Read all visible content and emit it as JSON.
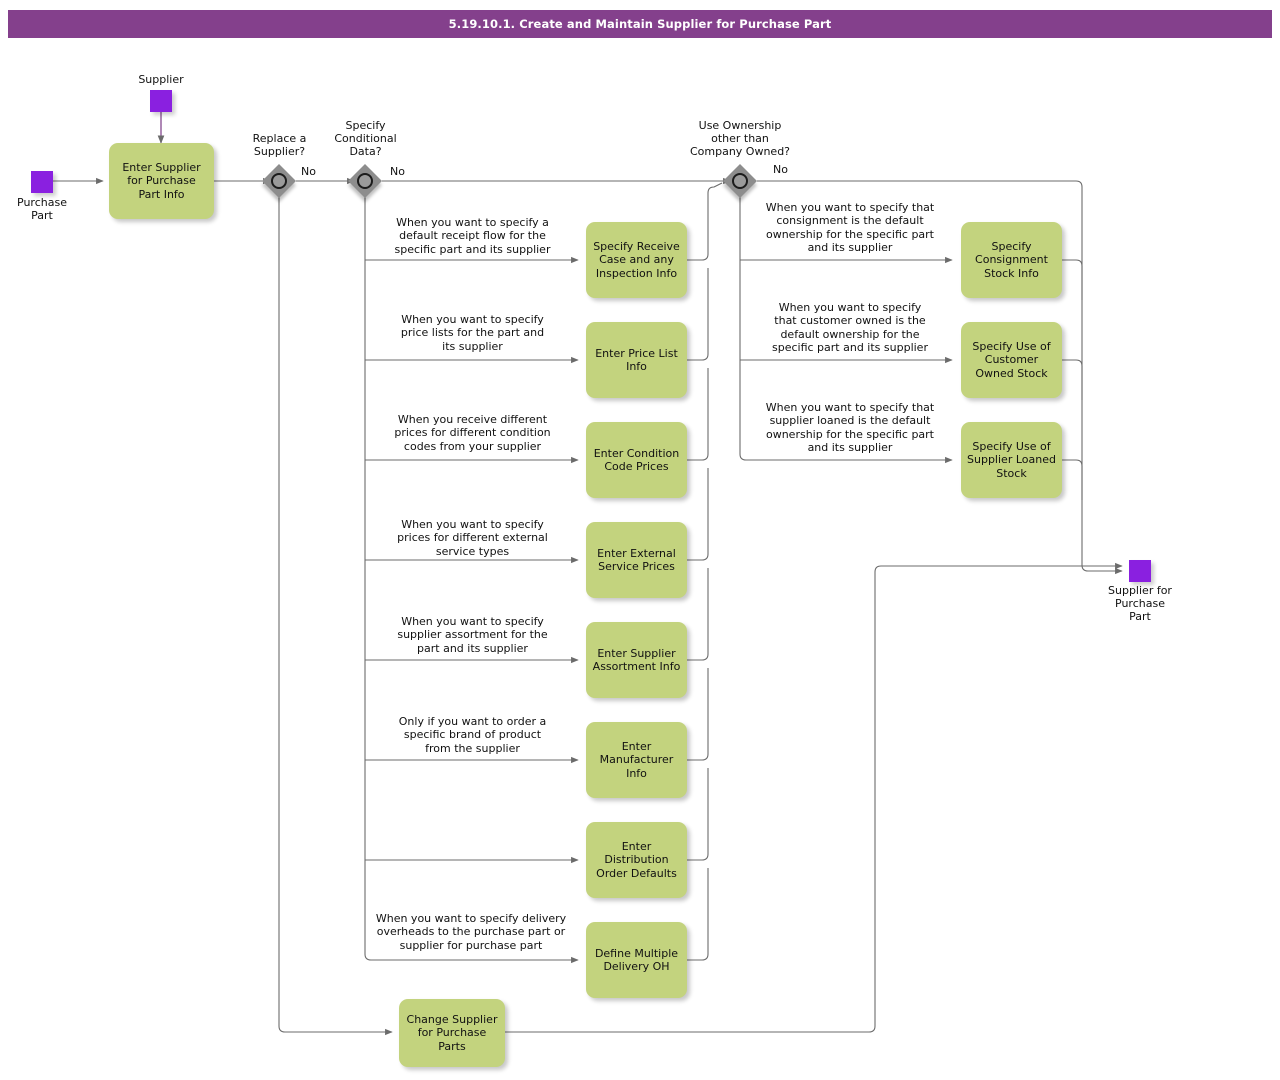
{
  "title": "5.19.10.1. Create and Maintain Supplier for Purchase Part",
  "colors": {
    "title_bar": "#84408c",
    "task_fill": "#c3d37e",
    "data_object_fill": "#8a20e0",
    "gateway_fill": "#8d8d8d",
    "connector": "#6b6b6b"
  },
  "data_objects": {
    "start_purchase_part": "Purchase\nPart",
    "supplier_input": "Supplier",
    "end_supplier_for_purchase_part": "Supplier for\nPurchase\nPart"
  },
  "gateways": [
    {
      "id": "gw-replace-supplier",
      "label": "Replace a\nSupplier?",
      "default_label": "No"
    },
    {
      "id": "gw-specify-conditional-data",
      "label": "Specify\nConditional\nData?",
      "default_label": "No"
    },
    {
      "id": "gw-use-ownership",
      "label": "Use Ownership\nother than\nCompany Owned?",
      "default_label": "No"
    }
  ],
  "tasks": {
    "enter_supplier_for_purchase_part_info": "Enter Supplier\nfor Purchase\nPart Info",
    "specify_receive_case": "Specify Receive\nCase and any\nInspection Info",
    "enter_price_list_info": "Enter Price List\nInfo",
    "enter_condition_code_prices": "Enter Condition\nCode Prices",
    "enter_external_service_prices": "Enter External\nService Prices",
    "enter_supplier_assortment_info": "Enter Supplier\nAssortment Info",
    "enter_manufacturer_info": "Enter\nManufacturer\nInfo",
    "enter_distribution_order_defaults": "Enter\nDistribution\nOrder Defaults",
    "define_multiple_delivery_oh": "Define Multiple\nDelivery OH",
    "change_supplier_for_purchase_parts": "Change Supplier\nfor Purchase\nParts",
    "specify_consignment_stock_info": "Specify\nConsignment\nStock Info",
    "specify_use_of_customer_owned_stock": "Specify Use of\nCustomer\nOwned Stock",
    "specify_use_of_supplier_loaned_stock": "Specify Use of\nSupplier Loaned\nStock"
  },
  "conditions": {
    "receive_case": "When you want to specify a\ndefault receipt flow for the\nspecific part and its supplier",
    "price_list": "When you want to specify\nprice lists for the part and\nits supplier",
    "condition_code": "When you receive different\nprices for different condition\ncodes from your supplier",
    "external_service": "When you want to specify\nprices for different external\nservice types",
    "supplier_assortment": "When you want to specify\nsupplier assortment for the\npart and its supplier",
    "manufacturer": "Only if you want to order a\nspecific brand of product\nfrom the supplier",
    "distribution_order_defaults": "",
    "multiple_delivery_oh": "When you want to specify delivery\noverheads to the purchase part or\nsupplier for purchase part",
    "consignment": "When you want to specify that\nconsignment is the default\nownership for the specific part\nand its supplier",
    "customer_owned": "When you want to specify\nthat customer owned is the\ndefault ownership for the\nspecific part and its supplier",
    "supplier_loaned": "When you want to specify that\nsupplier loaned is the default\nownership for the specific part\nand its supplier"
  }
}
